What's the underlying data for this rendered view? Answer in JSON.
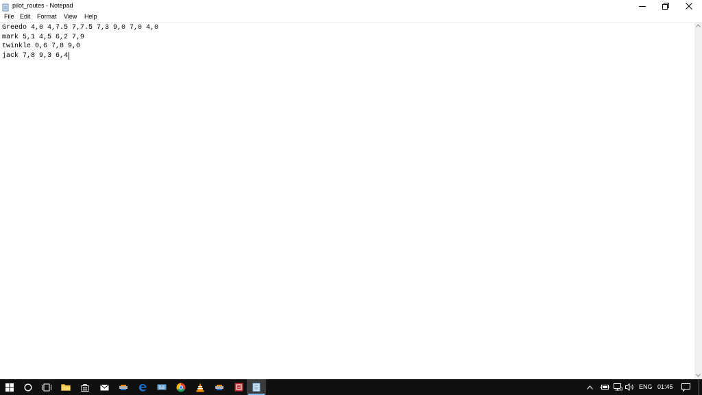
{
  "window": {
    "title": "pilot_routes - Notepad"
  },
  "menu": [
    "File",
    "Edit",
    "Format",
    "View",
    "Help"
  ],
  "editor": {
    "lines": [
      "Greedo 4,0 4,7.5 7,7.5 7,3 9,0 7,0 4,0",
      "mark 5,1 4,5 6,2 7,9",
      "twinkle 0,6 7,8 9,0",
      "jack 7,8 9,3 6,4"
    ]
  },
  "taskbar": {
    "tray": {
      "language": "ENG",
      "time": "01:45"
    }
  },
  "colors": {
    "taskbar_bg": "#101010",
    "accent": "#7fb8e6",
    "edge_blue": "#1e6fd0",
    "vlc_orange": "#f08a00"
  }
}
